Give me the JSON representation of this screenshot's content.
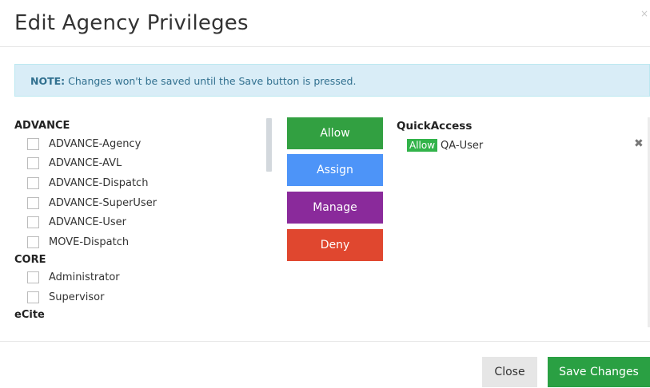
{
  "dialog": {
    "title": "Edit Agency Privileges",
    "close_glyph": "×"
  },
  "note": {
    "label": "NOTE:",
    "text": " Changes won't be saved until the Save button is pressed."
  },
  "privileges": {
    "groups": [
      {
        "name": "ADVANCE",
        "items": [
          "ADVANCE-Agency",
          "ADVANCE-AVL",
          "ADVANCE-Dispatch",
          "ADVANCE-SuperUser",
          "ADVANCE-User",
          "MOVE-Dispatch"
        ]
      },
      {
        "name": "CORE",
        "items": [
          "Administrator",
          "Supervisor"
        ]
      },
      {
        "name": "eCite",
        "items": []
      }
    ]
  },
  "actions": {
    "allow": "Allow",
    "assign": "Assign",
    "manage": "Manage",
    "deny": "Deny"
  },
  "assigned": {
    "title": "QuickAccess",
    "entries": [
      {
        "badge": "Allow",
        "name": "QA-User",
        "badge_color": "#32b34a"
      }
    ],
    "remove_glyph": "✖"
  },
  "footer": {
    "close_label": "Close",
    "save_label": "Save Changes"
  },
  "colors": {
    "allow": "#32a041",
    "assign": "#4d94f8",
    "manage": "#8a2a9b",
    "deny": "#e0472f",
    "save": "#2aa043",
    "note_bg": "#d9edf7"
  }
}
